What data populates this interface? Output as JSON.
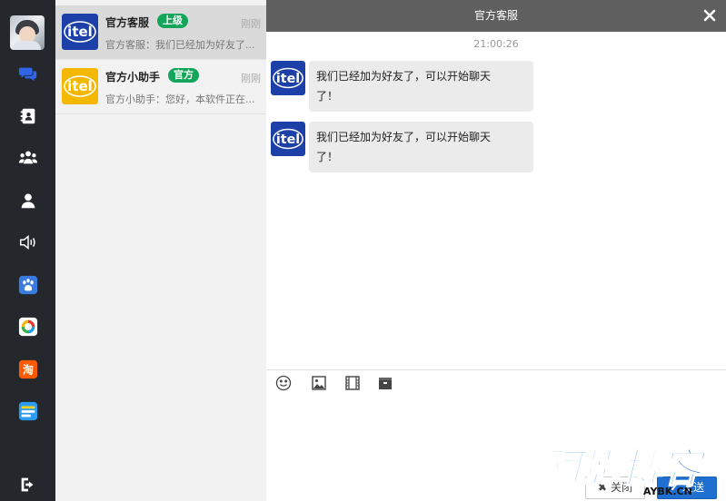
{
  "rail": {
    "items": [
      {
        "name": "chat-icon"
      },
      {
        "name": "contacts-icon"
      },
      {
        "name": "group-icon"
      },
      {
        "name": "user-icon"
      },
      {
        "name": "speaker-icon"
      },
      {
        "name": "paw-app-icon"
      },
      {
        "name": "ring-app-icon"
      },
      {
        "name": "taobao-app-icon"
      },
      {
        "name": "notes-app-icon"
      }
    ],
    "logout_icon": "logout-icon"
  },
  "conversations": [
    {
      "name": "官方客服",
      "badge": "上级",
      "time": "刚刚",
      "preview": "官方客服：我们已经加为好友了..."
    },
    {
      "name": "官方小助手",
      "badge": "官方",
      "time": "刚刚",
      "preview": "官方小助手：您好，本软件正在..."
    }
  ],
  "chat": {
    "title": "官方客服",
    "timestamp": "21:00:26",
    "messages": [
      {
        "line1": "我们已经加为好友了，可以开始聊天",
        "line2": "了！"
      },
      {
        "line1": "我们已经加为好友了，可以开始聊天",
        "line2": "了！"
      }
    ],
    "avatar_text": "itel"
  },
  "toolbar": {
    "items": [
      "emoji-icon",
      "image-icon",
      "video-icon",
      "file-icon"
    ]
  },
  "buttons": {
    "close_label": "关闭",
    "send_label": "发送"
  },
  "watermark": {
    "big": "阿影博客",
    "small": "AYBK.CN"
  },
  "colors": {
    "rail_bg": "#24282d",
    "header_bg": "#5f5f5f",
    "badge_green": "#13a65a",
    "send_blue": "#1f6fd1"
  }
}
